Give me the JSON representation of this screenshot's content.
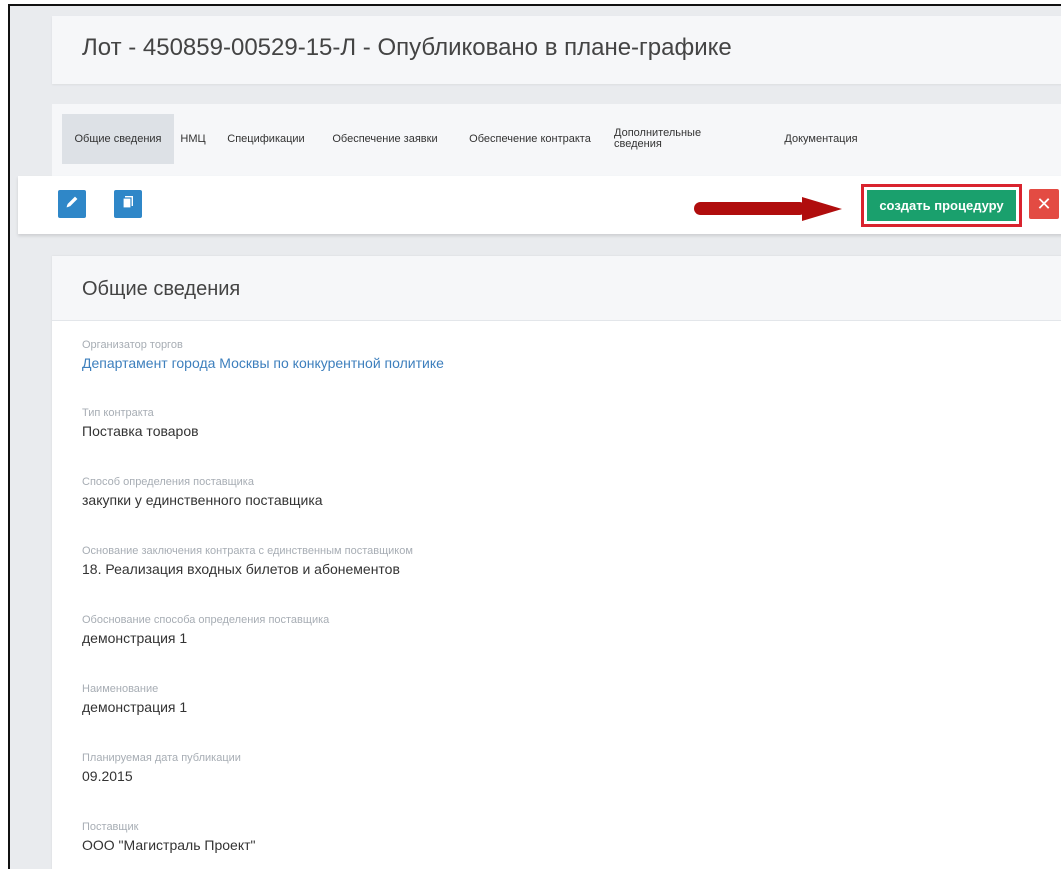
{
  "page": {
    "title": "Лот - 450859-00529-15-Л - Опубликовано в плане-графике"
  },
  "tabs": [
    {
      "label": "Общие сведения",
      "active": true
    },
    {
      "label": "НМЦ"
    },
    {
      "label": "Спецификации"
    },
    {
      "label": "Обеспечение заявки"
    },
    {
      "label": "Обеспечение контракта"
    },
    {
      "label": "Дополнительные сведения"
    },
    {
      "label": "Документация"
    }
  ],
  "toolbar": {
    "edit_icon": "pencil-icon",
    "copy_icon": "copy-document-icon",
    "arrow_icon": "red-arrow-right-icon",
    "create_label": "создать процедуру",
    "close_icon": "close-icon",
    "close_symbol": "✕"
  },
  "section": {
    "title": "Общие сведения",
    "fields": [
      {
        "label": "Организатор торгов",
        "value": "Департамент города Москвы по конкурентной политике",
        "link": true
      },
      {
        "label": "Тип контракта",
        "value": "Поставка товаров"
      },
      {
        "label": "Способ определения поставщика",
        "value": "закупки у единственного поставщика"
      },
      {
        "label": "Основание заключения контракта с единственным поставщиком",
        "value": "18. Реализация входных билетов и абонементов"
      },
      {
        "label": "Обоснование способа определения поставщика",
        "value": "демонстрация 1"
      },
      {
        "label": "Наименование",
        "value": "демонстрация 1"
      },
      {
        "label": "Планируемая дата публикации",
        "value": "09.2015"
      },
      {
        "label": "Поставщик",
        "value": "ООО \"Магистраль Проект\""
      }
    ]
  },
  "colors": {
    "accent_blue": "#2f87c8",
    "create_green": "#1aa06d",
    "highlight_red": "#d9232e",
    "close_red": "#e34b43",
    "arrow_red": "#b00d0d",
    "link_blue": "#3d7fbd"
  }
}
